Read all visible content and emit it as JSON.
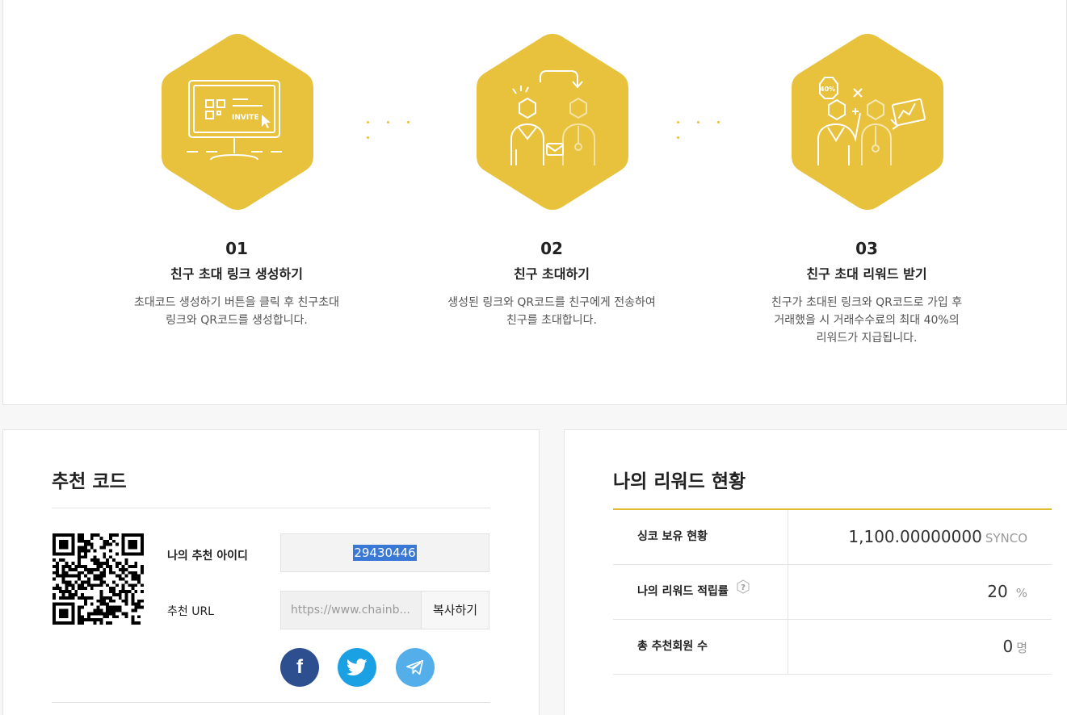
{
  "steps": [
    {
      "num": "01",
      "title": "친구 초대 링크 생성하기",
      "desc": "초대코드 생성하기 버튼을 클릭 후 친구초대\n링크와 QR코드를 생성합니다.",
      "icon_text": "INVITE"
    },
    {
      "num": "02",
      "title": "친구 초대하기",
      "desc": "생성된 링크와 QR코드를 친구에게 전송하여\n친구를 초대합니다."
    },
    {
      "num": "03",
      "title": "친구 초대 리워드 받기",
      "desc": "친구가 초대된 링크와 QR코드로 가입 후\n거래했을 시 거래수수료의 최대 40%의\n리워드가 지급됩니다.",
      "icon_text": "40%"
    }
  ],
  "referral": {
    "title": "추천 코드",
    "id_label": "나의 추천 아이디",
    "id_value": "29430446",
    "url_label": "추천 URL",
    "url_value": "https://www.chainb...",
    "copy_label": "복사하기",
    "social": [
      {
        "name": "facebook",
        "glyph": "f"
      },
      {
        "name": "twitter"
      },
      {
        "name": "telegram"
      }
    ]
  },
  "reward": {
    "title": "나의 리워드 현황",
    "rows": [
      {
        "label": "싱코 보유 현황",
        "value": "1,100.00000000",
        "unit": "SYNCO"
      },
      {
        "label": "나의 리워드 적립률",
        "value": "20",
        "unit": "%",
        "help": "?"
      },
      {
        "label": "총 추천회원 수",
        "value": "0",
        "unit": "명"
      }
    ]
  },
  "colors": {
    "accent": "#e8c23c",
    "icon_line": "#ffffff",
    "facebook": "#2d4f8f",
    "twitter": "#1aa1e3",
    "telegram": "#53aeea",
    "selection": "#3a78d6"
  }
}
